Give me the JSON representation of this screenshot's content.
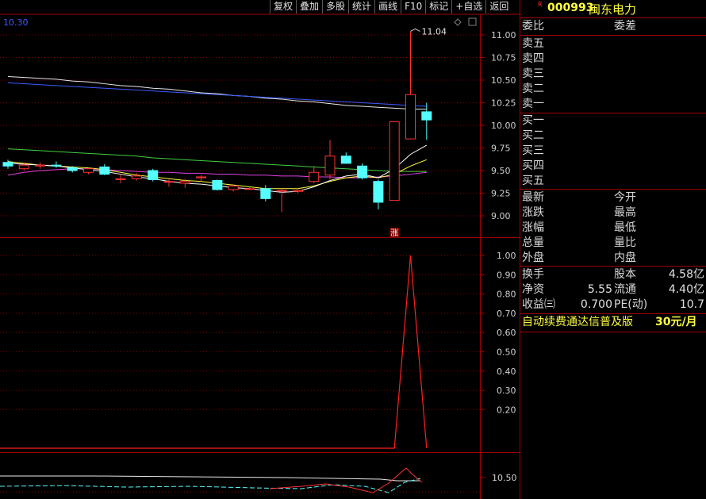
{
  "toolbar": {
    "buttons": [
      "复权",
      "叠加",
      "多股",
      "统计",
      "画线",
      "F10",
      "标记",
      "+自选",
      "返回"
    ]
  },
  "chart": {
    "top_left_value": "10.30",
    "peak_label": "11.04",
    "limit_up_marker": "涨",
    "price_ticks": [
      "11.00",
      "10.75",
      "10.50",
      "10.25",
      "10.00",
      "9.75",
      "9.50",
      "9.25",
      "9.00"
    ],
    "indicator_ticks": [
      "1.00",
      "0.90",
      "0.80",
      "0.70",
      "0.60",
      "0.50",
      "0.40",
      "0.30",
      "0.20"
    ],
    "volume_tick": "10.50"
  },
  "chart_data": [
    {
      "type": "candlestick",
      "y_axis": {
        "ticks": [
          9.0,
          9.25,
          9.5,
          9.75,
          10.0,
          10.25,
          10.5,
          10.75,
          11.0
        ]
      },
      "annotations": [
        "11.04"
      ],
      "candles": [
        {
          "o": 9.59,
          "h": 9.62,
          "l": 9.52,
          "c": 9.55
        },
        {
          "o": 9.52,
          "h": 9.58,
          "l": 9.5,
          "c": 9.56
        },
        {
          "o": 9.55,
          "h": 9.59,
          "l": 9.52,
          "c": 9.56
        },
        {
          "o": 9.56,
          "h": 9.6,
          "l": 9.53,
          "c": 9.55
        },
        {
          "o": 9.53,
          "h": 9.55,
          "l": 9.48,
          "c": 9.5
        },
        {
          "o": 9.48,
          "h": 9.53,
          "l": 9.46,
          "c": 9.52
        },
        {
          "o": 9.54,
          "h": 9.57,
          "l": 9.45,
          "c": 9.46
        },
        {
          "o": 9.4,
          "h": 9.46,
          "l": 9.36,
          "c": 9.41
        },
        {
          "o": 9.41,
          "h": 9.47,
          "l": 9.39,
          "c": 9.44
        },
        {
          "o": 9.5,
          "h": 9.52,
          "l": 9.38,
          "c": 9.4
        },
        {
          "o": 9.38,
          "h": 9.4,
          "l": 9.32,
          "c": 9.38
        },
        {
          "o": 9.36,
          "h": 9.41,
          "l": 9.31,
          "c": 9.38
        },
        {
          "o": 9.42,
          "h": 9.45,
          "l": 9.38,
          "c": 9.43
        },
        {
          "o": 9.39,
          "h": 9.4,
          "l": 9.28,
          "c": 9.29
        },
        {
          "o": 9.29,
          "h": 9.35,
          "l": 9.27,
          "c": 9.33
        },
        {
          "o": 9.3,
          "h": 9.32,
          "l": 9.29,
          "c": 9.3
        },
        {
          "o": 9.3,
          "h": 9.34,
          "l": 9.16,
          "c": 9.19
        },
        {
          "o": 9.28,
          "h": 9.3,
          "l": 9.04,
          "c": 9.28
        },
        {
          "o": 9.27,
          "h": 9.31,
          "l": 9.25,
          "c": 9.28
        },
        {
          "o": 9.38,
          "h": 9.55,
          "l": 9.36,
          "c": 9.48
        },
        {
          "o": 9.45,
          "h": 9.84,
          "l": 9.4,
          "c": 9.66
        },
        {
          "o": 9.66,
          "h": 9.7,
          "l": 9.58,
          "c": 9.58
        },
        {
          "o": 9.55,
          "h": 9.58,
          "l": 9.4,
          "c": 9.42
        },
        {
          "o": 9.38,
          "h": 9.4,
          "l": 9.07,
          "c": 9.15
        },
        {
          "o": 9.17,
          "h": 10.04,
          "l": 9.17,
          "c": 10.04
        },
        {
          "o": 9.85,
          "h": 11.04,
          "l": 9.85,
          "c": 10.34
        },
        {
          "o": 10.15,
          "h": 10.25,
          "l": 9.84,
          "c": 10.06
        }
      ],
      "moving_averages": [
        {
          "color": "#e8e8e8",
          "values": [
            10.54,
            10.53,
            10.52,
            10.51,
            10.49,
            10.48,
            10.46,
            10.44,
            10.43,
            10.41,
            10.4,
            10.38,
            10.36,
            10.35,
            10.33,
            10.32,
            10.3,
            10.29,
            10.27,
            10.26,
            10.24,
            10.22,
            10.21,
            10.2,
            10.19,
            10.18,
            10.18
          ]
        },
        {
          "color": "#3b5bff",
          "values": [
            10.47,
            10.46,
            10.45,
            10.44,
            10.43,
            10.42,
            10.41,
            10.4,
            10.39,
            10.38,
            10.37,
            10.36,
            10.35,
            10.34,
            10.33,
            10.32,
            10.31,
            10.3,
            10.29,
            10.28,
            10.27,
            10.26,
            10.25,
            10.24,
            10.23,
            10.22,
            10.21
          ]
        },
        {
          "color": "#40d040",
          "values": [
            9.74,
            9.73,
            9.72,
            9.71,
            9.7,
            9.69,
            9.68,
            9.67,
            9.66,
            9.64,
            9.63,
            9.62,
            9.61,
            9.6,
            9.59,
            9.58,
            9.57,
            9.56,
            9.55,
            9.54,
            9.53,
            9.52,
            9.51,
            9.5,
            9.49,
            9.49,
            9.49
          ]
        },
        {
          "color": "#e040e0",
          "values": [
            9.45,
            9.48,
            9.5,
            9.51,
            9.52,
            9.52,
            9.51,
            9.5,
            9.49,
            9.48,
            9.48,
            9.47,
            9.47,
            9.46,
            9.46,
            9.45,
            9.45,
            9.44,
            9.44,
            9.43,
            9.43,
            9.42,
            9.42,
            9.43,
            9.44,
            9.46,
            9.48
          ]
        },
        {
          "color": "#ffff40",
          "values": [
            9.6,
            9.58,
            9.56,
            9.55,
            9.54,
            9.53,
            9.51,
            9.48,
            9.45,
            9.43,
            9.41,
            9.39,
            9.38,
            9.36,
            9.34,
            9.32,
            9.3,
            9.3,
            9.3,
            9.33,
            9.38,
            9.42,
            9.44,
            9.42,
            9.46,
            9.55,
            9.62
          ]
        },
        {
          "color": "#ffffff",
          "values": [
            9.58,
            9.57,
            9.56,
            9.55,
            9.53,
            9.51,
            9.49,
            9.46,
            9.43,
            9.41,
            9.38,
            9.36,
            9.35,
            9.33,
            9.31,
            9.3,
            9.28,
            9.26,
            9.27,
            9.32,
            9.39,
            9.44,
            9.46,
            9.42,
            9.52,
            9.68,
            9.78
          ]
        }
      ]
    },
    {
      "type": "line",
      "y_axis": {
        "ticks": [
          0.2,
          0.3,
          0.4,
          0.5,
          0.6,
          0.7,
          0.8,
          0.9,
          1.0
        ]
      },
      "series": [
        {
          "color": "#ff2020",
          "values": [
            0,
            0,
            0,
            0,
            0,
            0,
            0,
            0,
            0,
            0,
            0,
            0,
            0,
            0,
            0,
            0,
            0,
            0,
            0,
            0,
            0,
            0,
            0,
            0,
            0,
            1,
            0,
            0
          ]
        }
      ]
    }
  ],
  "quote_panel": {
    "code": "000993",
    "name": "闽东电力",
    "r_badge": "R",
    "wei_bi": "委比",
    "wei_cha": "委差",
    "sell_rows": [
      "卖五",
      "卖四",
      "卖三",
      "卖二",
      "卖一"
    ],
    "buy_rows": [
      "买一",
      "买二",
      "买三",
      "买四",
      "买五"
    ],
    "stats_left": [
      "最新",
      "涨跌",
      "涨幅",
      "总量",
      "外盘"
    ],
    "stats_right": [
      "今开",
      "最高",
      "最低",
      "量比",
      "内盘"
    ],
    "huan_shou": "换手",
    "gu_ben": "股本",
    "gu_ben_value": "4.58亿",
    "jing_zi": "净资",
    "jing_zi_value": "5.55",
    "liu_tong": "流通",
    "liu_tong_value": "4.40亿",
    "shou_yi": "收益㈢",
    "shou_yi_value": "0.700",
    "pe": "PE(动)",
    "pe_value": "10.7",
    "promo_text": "自动续费通达信普及版",
    "promo_price": "30元/月"
  }
}
